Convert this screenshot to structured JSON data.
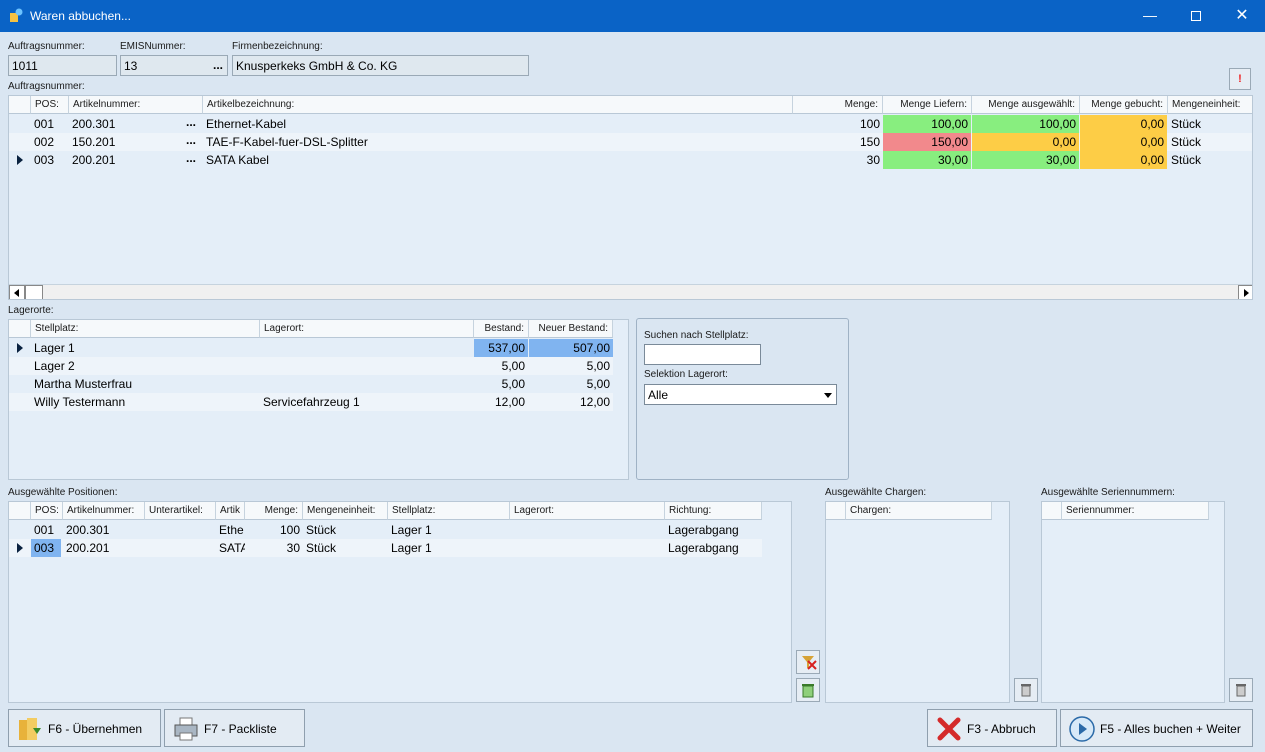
{
  "window": {
    "title": "Waren abbuchen..."
  },
  "header": {
    "auftragsnummer_label": "Auftragsnummer:",
    "auftragsnummer_value": "1011",
    "emis_label": "EMISNummer:",
    "emis_value": "13",
    "emis_btn": "...",
    "firma_label": "Firmenbezeichnung:",
    "firma_value": "Knusperkeks GmbH & Co. KG",
    "section_label": "Auftragsnummer:"
  },
  "order_grid": {
    "columns": [
      "POS:",
      "Artikelnummer:",
      "Artikelbezeichnung:",
      "Menge:",
      "Menge Liefern:",
      "Menge ausgewählt:",
      "Menge gebucht:",
      "Mengeneinheit:"
    ],
    "rows": [
      {
        "pos": "001",
        "artnr": "200.301",
        "btn": "...",
        "bez": "Ethernet-Kabel",
        "menge": "100",
        "liefern": "100,00",
        "ausgewaehlt": "100,00",
        "gebucht": "0,00",
        "einheit": "Stück",
        "liefern_color": "green",
        "ausgewaehlt_color": "green"
      },
      {
        "pos": "002",
        "artnr": "150.201",
        "btn": "...",
        "bez": "TAE-F-Kabel-fuer-DSL-Splitter",
        "menge": "150",
        "liefern": "150,00",
        "ausgewaehlt": "0,00",
        "gebucht": "0,00",
        "einheit": "Stück",
        "liefern_color": "red",
        "ausgewaehlt_color": "yellow"
      },
      {
        "pos": "003",
        "artnr": "200.201",
        "btn": "...",
        "bez": "SATA Kabel",
        "menge": "30",
        "liefern": "30,00",
        "ausgewaehlt": "30,00",
        "gebucht": "0,00",
        "einheit": "Stück",
        "liefern_color": "green",
        "ausgewaehlt_color": "green"
      }
    ]
  },
  "lagerorte": {
    "label": "Lagerorte:",
    "columns": [
      "Stellplatz:",
      "Lagerort:",
      "Bestand:",
      "Neuer Bestand:"
    ],
    "rows": [
      {
        "stellplatz": "Lager 1",
        "lagerort": "",
        "bestand": "537,00",
        "neu": "507,00"
      },
      {
        "stellplatz": "Lager 2",
        "lagerort": "",
        "bestand": "5,00",
        "neu": "5,00"
      },
      {
        "stellplatz": "Martha Musterfrau",
        "lagerort": "",
        "bestand": "5,00",
        "neu": "5,00"
      },
      {
        "stellplatz": "Willy Testermann",
        "lagerort": "Servicefahrzeug 1",
        "bestand": "12,00",
        "neu": "12,00"
      }
    ]
  },
  "search": {
    "label": "Suchen nach Stellplatz:",
    "value": "",
    "select_label": "Selektion Lagerort:",
    "select_value": "Alle"
  },
  "positions": {
    "label": "Ausgewählte Positionen:",
    "columns": [
      "POS:",
      "Artikelnummer:",
      "Unterartikel:",
      "Artik",
      "Menge:",
      "Mengeneinheit:",
      "Stellplatz:",
      "Lagerort:",
      "Richtung:"
    ],
    "rows": [
      {
        "pos": "001",
        "artnr": "200.301",
        "unter": "",
        "art": "Ethe",
        "menge": "100",
        "einheit": "Stück",
        "stellplatz": "Lager 1",
        "lagerort": "",
        "richtung": "Lagerabgang"
      },
      {
        "pos": "003",
        "artnr": "200.201",
        "unter": "",
        "art": "SATA",
        "menge": "30",
        "einheit": "Stück",
        "stellplatz": "Lager 1",
        "lagerort": "",
        "richtung": "Lagerabgang"
      }
    ]
  },
  "chargen": {
    "label": "Ausgewählte Chargen:",
    "column": "Chargen:"
  },
  "serien": {
    "label": "Ausgewählte Seriennummern:",
    "column": "Seriennummer:"
  },
  "footer": {
    "uebernehmen": "F6 - Übernehmen",
    "packliste": "F7 - Packliste",
    "abbruch": "F3 - Abbruch",
    "buchen": "F5 - Alles buchen + Weiter"
  },
  "colors": {
    "titlebar": "#0a63c6",
    "green": "#88ee7f",
    "red": "#f2898c",
    "yellow": "#fdcd46",
    "selected": "#80b4f0"
  }
}
